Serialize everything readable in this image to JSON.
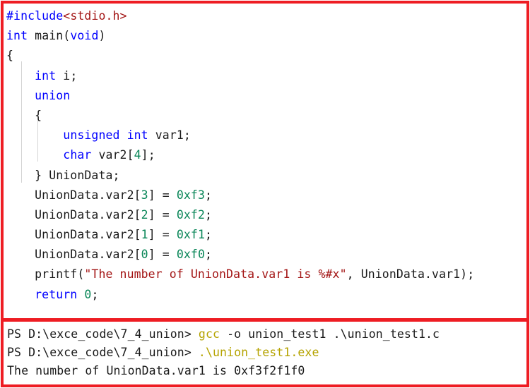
{
  "theme": {
    "frame_color": "#ee1d23",
    "background": "#ffffff",
    "keyword_color": "#0000ff",
    "string_color": "#a31515",
    "number_color": "#098658",
    "text_color": "#1a1a1a",
    "command_color": "#b5a300",
    "indent_guide_color": "#d4d4d4"
  },
  "editor": {
    "language": "c",
    "lines": [
      {
        "indent": 0,
        "tokens": [
          {
            "t": "#include",
            "c": "pre"
          },
          {
            "t": "<stdio.h>",
            "c": "hdr"
          }
        ]
      },
      {
        "indent": 0,
        "tokens": [
          {
            "t": "int",
            "c": "kw"
          },
          {
            "t": " ",
            "c": "id"
          },
          {
            "t": "main",
            "c": "id"
          },
          {
            "t": "(",
            "c": "id"
          },
          {
            "t": "void",
            "c": "kw"
          },
          {
            "t": ")",
            "c": "id"
          }
        ]
      },
      {
        "indent": 0,
        "tokens": [
          {
            "t": "{",
            "c": "id"
          }
        ]
      },
      {
        "indent": 0,
        "tokens": [
          {
            "t": "    ",
            "c": "id"
          },
          {
            "t": "int",
            "c": "kw"
          },
          {
            "t": " i;",
            "c": "id"
          }
        ]
      },
      {
        "indent": 0,
        "tokens": [
          {
            "t": "    ",
            "c": "id"
          },
          {
            "t": "union",
            "c": "kw"
          }
        ]
      },
      {
        "indent": 0,
        "tokens": [
          {
            "t": "    {",
            "c": "id"
          }
        ]
      },
      {
        "indent": 0,
        "tokens": [
          {
            "t": "        ",
            "c": "id"
          },
          {
            "t": "unsigned",
            "c": "kw"
          },
          {
            "t": " ",
            "c": "id"
          },
          {
            "t": "int",
            "c": "kw"
          },
          {
            "t": " var1;",
            "c": "id"
          }
        ]
      },
      {
        "indent": 0,
        "tokens": [
          {
            "t": "        ",
            "c": "id"
          },
          {
            "t": "char",
            "c": "kw"
          },
          {
            "t": " var2[",
            "c": "id"
          },
          {
            "t": "4",
            "c": "num"
          },
          {
            "t": "];",
            "c": "id"
          }
        ]
      },
      {
        "indent": 0,
        "tokens": [
          {
            "t": "    } UnionData;",
            "c": "id"
          }
        ]
      },
      {
        "indent": 0,
        "tokens": [
          {
            "t": "    UnionData.var2[",
            "c": "id"
          },
          {
            "t": "3",
            "c": "num"
          },
          {
            "t": "] = ",
            "c": "id"
          },
          {
            "t": "0xf3",
            "c": "num"
          },
          {
            "t": ";",
            "c": "id"
          }
        ]
      },
      {
        "indent": 0,
        "tokens": [
          {
            "t": "    UnionData.var2[",
            "c": "id"
          },
          {
            "t": "2",
            "c": "num"
          },
          {
            "t": "] = ",
            "c": "id"
          },
          {
            "t": "0xf2",
            "c": "num"
          },
          {
            "t": ";",
            "c": "id"
          }
        ]
      },
      {
        "indent": 0,
        "tokens": [
          {
            "t": "    UnionData.var2[",
            "c": "id"
          },
          {
            "t": "1",
            "c": "num"
          },
          {
            "t": "] = ",
            "c": "id"
          },
          {
            "t": "0xf1",
            "c": "num"
          },
          {
            "t": ";",
            "c": "id"
          }
        ]
      },
      {
        "indent": 0,
        "tokens": [
          {
            "t": "    UnionData.var2[",
            "c": "id"
          },
          {
            "t": "0",
            "c": "num"
          },
          {
            "t": "] = ",
            "c": "id"
          },
          {
            "t": "0xf0",
            "c": "num"
          },
          {
            "t": ";",
            "c": "id"
          }
        ]
      },
      {
        "indent": 0,
        "tokens": [
          {
            "t": "    printf(",
            "c": "id"
          },
          {
            "t": "\"The number of UnionData.var1 is %#x\"",
            "c": "str"
          },
          {
            "t": ", UnionData.var1);",
            "c": "id"
          }
        ]
      },
      {
        "indent": 0,
        "tokens": [
          {
            "t": "    ",
            "c": "id"
          },
          {
            "t": "return",
            "c": "kw"
          },
          {
            "t": " ",
            "c": "id"
          },
          {
            "t": "0",
            "c": "num"
          },
          {
            "t": ";",
            "c": "id"
          }
        ]
      },
      {
        "indent": 0,
        "tokens": []
      },
      {
        "indent": 0,
        "tokens": [
          {
            "t": "}",
            "c": "id"
          }
        ]
      }
    ],
    "plain_text": "#include<stdio.h>\nint main(void)\n{\n    int i;\n    union\n    {\n        unsigned int var1;\n        char var2[4];\n    } UnionData;\n    UnionData.var2[3] = 0xf3;\n    UnionData.var2[2] = 0xf2;\n    UnionData.var2[1] = 0xf1;\n    UnionData.var2[0] = 0xf0;\n    printf(\"The number of UnionData.var1 is %#x\", UnionData.var1);\n    return 0;\n\n}"
  },
  "terminal": {
    "shell": "PowerShell",
    "lines": [
      {
        "type": "command",
        "prompt": "PS D:\\exce_code\\7_4_union> ",
        "command": "gcc",
        "args": " -o union_test1 .\\union_test1.c"
      },
      {
        "type": "command",
        "prompt": "PS D:\\exce_code\\7_4_union> ",
        "command": ".\\union_test1.exe",
        "args": ""
      },
      {
        "type": "output",
        "text": "The number of UnionData.var1 is 0xf3f2f1f0"
      }
    ]
  }
}
